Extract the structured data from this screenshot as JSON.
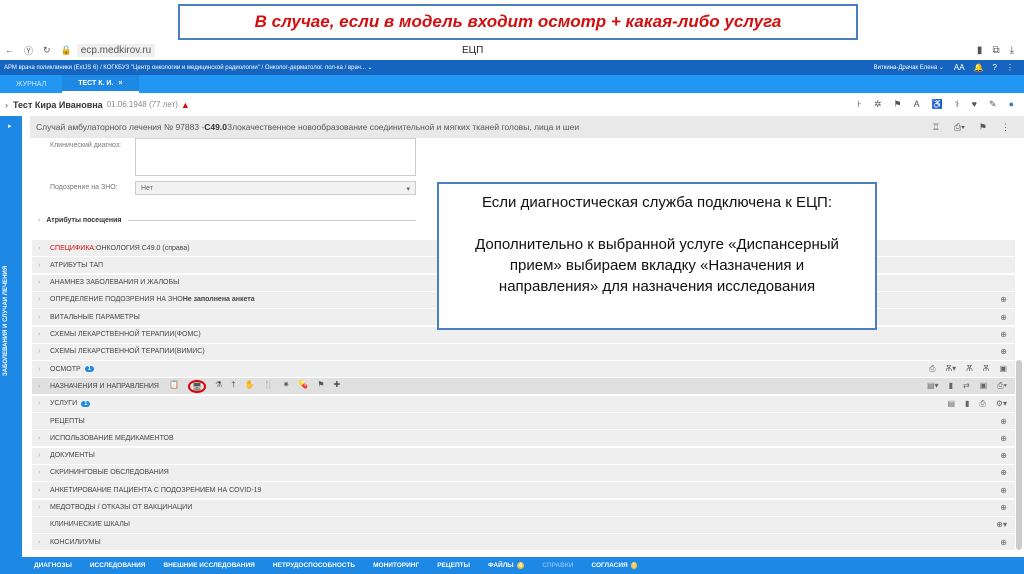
{
  "banner": "В случае, если в модель входит осмотр + какая-либо услуга",
  "browser": {
    "url": "ecp.medkirov.ru",
    "title": "ЕЦП"
  },
  "appbar": {
    "path": "АРМ врача поликлиники (ExtJS 6) / КОГКБУЗ \"Центр онкологии и медицинской радиологии\" / Онколог-дерматолог. пол-ка / врач... ⌄",
    "user": "Виткина-Драчак Елена ⌄"
  },
  "tabs": [
    {
      "label": "ЖУРНАЛ"
    },
    {
      "label": "ТЕСТ К. И."
    }
  ],
  "patient": {
    "name": "Тест Кира Ивановна",
    "dob": "01.06.1948 (77 лет)"
  },
  "sidebar_label": "ЗАБОЛЕВАНИЯ И СЛУЧАИ ЛЕЧЕНИЯ",
  "case": {
    "prefix": "Случай амбулаторного лечения № 97883 - ",
    "code": "C49.0",
    "diagnosis": " Злокачественное новообразование соединительной и мягких тканей головы, лица и шеи"
  },
  "form": {
    "clinical_dx_label": "Клинический диагноз:",
    "zno_label": "Подозрение на ЗНО:",
    "zno_value": "Нет",
    "visit_attrs": "Атрибуты посещения"
  },
  "sections": [
    {
      "label": "ОНКОЛОГИЯ C49.0 (справа)",
      "prefix": "СПЕЦИФИКА:"
    },
    {
      "label": "АТРИБУТЫ ТАП"
    },
    {
      "label": "АНАМНЕЗ ЗАБОЛЕВАНИЯ И ЖАЛОБЫ"
    },
    {
      "label": "ОПРЕДЕЛЕНИЕ ПОДОЗРЕНИЯ НА ЗНО",
      "suffix": " Не заполнена анкета"
    },
    {
      "label": "ВИТАЛЬНЫЕ ПАРАМЕТРЫ"
    },
    {
      "label": "СХЕМЫ ЛЕКАРСТВЕННОЙ ТЕРАПИИ(ФОМС)"
    },
    {
      "label": "СХЕМЫ ЛЕКАРСТВЕННОЙ ТЕРАПИИ(ВИМИС)"
    },
    {
      "label": "ОСМОТР",
      "badge": "1"
    },
    {
      "label": "НАЗНАЧЕНИЯ И НАПРАВЛЕНИЯ"
    },
    {
      "label": "УСЛУГИ",
      "badge": "1"
    },
    {
      "label": "РЕЦЕПТЫ"
    },
    {
      "label": "ИСПОЛЬЗОВАНИЕ МЕДИКАМЕНТОВ"
    },
    {
      "label": "ДОКУМЕНТЫ"
    },
    {
      "label": "СКРИНИНГОВЫЕ ОБСЛЕДОВАНИЯ"
    },
    {
      "label": "АНКЕТИРОВАНИЕ ПАЦИЕНТА С ПОДОЗРЕНИЕМ НА COVID-19"
    },
    {
      "label": "МЕДОТВОДЫ / ОТКАЗЫ ОТ ВАКЦИНАЦИИ"
    },
    {
      "label": "КЛИНИЧЕСКИЕ ШКАЛЫ"
    },
    {
      "label": "КОНСИЛИУМЫ"
    }
  ],
  "callout": {
    "line1": "Если диагностическая служба подключена к ЕЦП:",
    "line2": "Дополнительно к выбранной услуге «Диспансерный прием» выбираем вкладку «Назначения и направления» для назначения исследования"
  },
  "bottom_tabs": [
    {
      "label": "ДИАГНОЗЫ"
    },
    {
      "label": "ИССЛЕДОВАНИЯ"
    },
    {
      "label": "ВНЕШНИЕ ИССЛЕДОВАНИЯ"
    },
    {
      "label": "НЕТРУДОСПОСОБНОСТЬ"
    },
    {
      "label": "МОНИТОРИНГ"
    },
    {
      "label": "РЕЦЕПТЫ"
    },
    {
      "label": "ФАЙЛЫ",
      "badge": "4"
    },
    {
      "label": "СПРАВКИ",
      "dim": true
    },
    {
      "label": "СОГЛАСИЯ",
      "badge": "!"
    }
  ],
  "colors": {
    "accent": "#1e88e5",
    "appbar": "#1565c0",
    "alert": "#d01010"
  }
}
